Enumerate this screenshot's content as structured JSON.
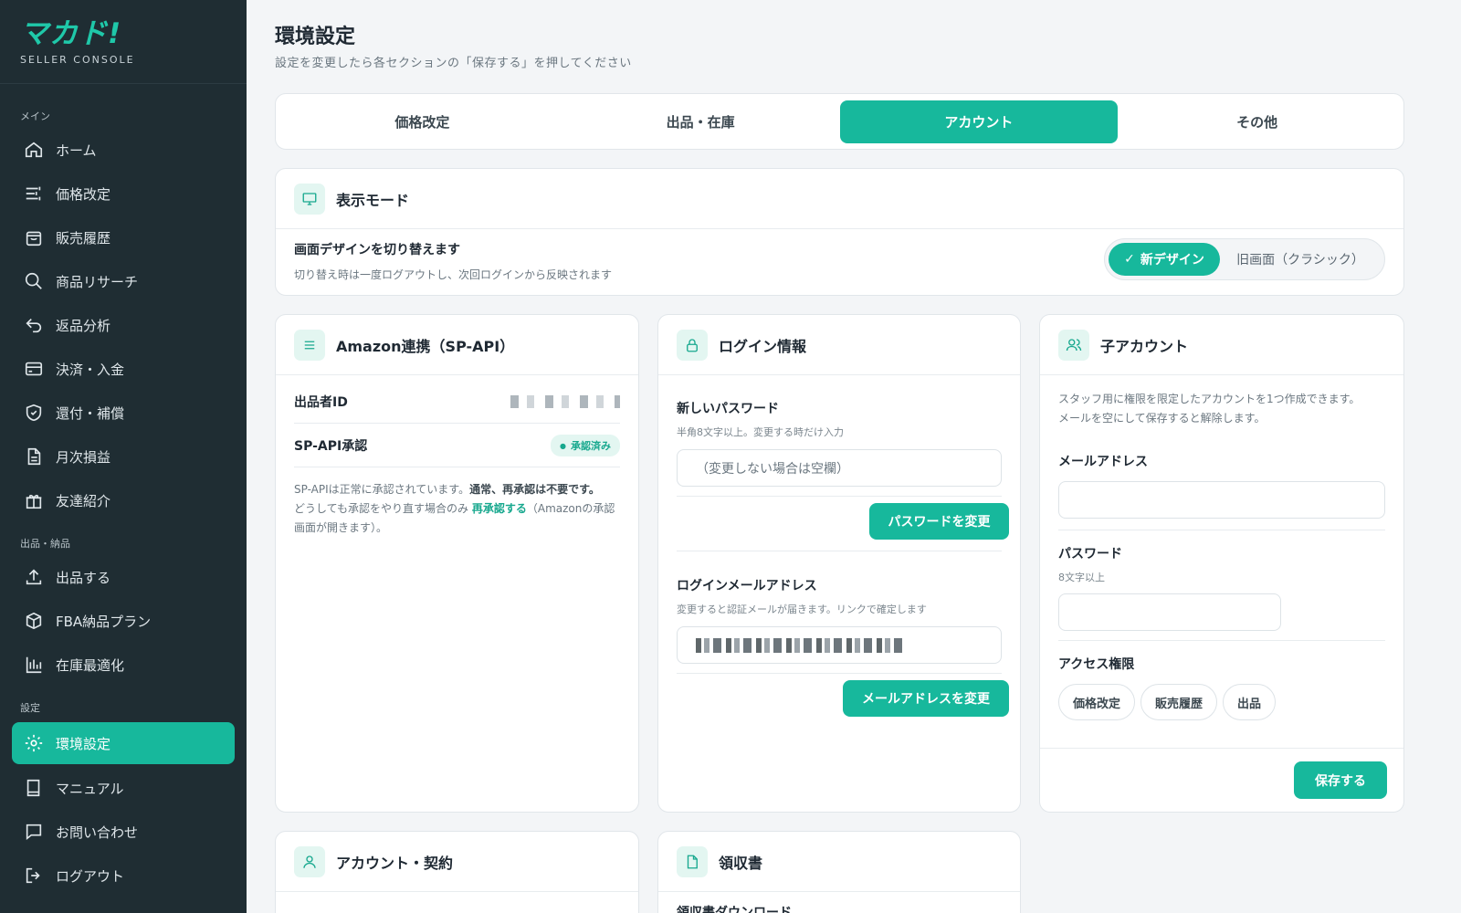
{
  "brand": {
    "logo": "マカド!",
    "sub": "SELLER CONSOLE"
  },
  "sidebar": {
    "sections": [
      {
        "label": "メイン"
      },
      {
        "label": "出品・納品"
      },
      {
        "label": "設定"
      }
    ],
    "items": [
      {
        "label": "ホーム",
        "icon": "home-icon"
      },
      {
        "label": "価格改定",
        "icon": "sliders-icon"
      },
      {
        "label": "販売履歴",
        "icon": "bag-icon"
      },
      {
        "label": "商品リサーチ",
        "icon": "search-icon"
      },
      {
        "label": "返品分析",
        "icon": "return-icon"
      },
      {
        "label": "決済・入金",
        "icon": "card-icon"
      },
      {
        "label": "還付・補償",
        "icon": "shield-icon"
      },
      {
        "label": "月次損益",
        "icon": "document-icon"
      },
      {
        "label": "友達紹介",
        "icon": "gift-icon"
      },
      {
        "label": "出品する",
        "icon": "upload-icon"
      },
      {
        "label": "FBA納品プラン",
        "icon": "box-icon"
      },
      {
        "label": "在庫最適化",
        "icon": "bar-chart-icon"
      },
      {
        "label": "環境設定",
        "icon": "gear-icon"
      },
      {
        "label": "マニュアル",
        "icon": "book-icon"
      },
      {
        "label": "お問い合わせ",
        "icon": "chat-icon"
      },
      {
        "label": "ログアウト",
        "icon": "logout-icon"
      }
    ]
  },
  "page": {
    "title": "環境設定",
    "subtitle": "設定を変更したら各セクションの「保存する」を押してください"
  },
  "tabs": [
    {
      "label": "価格改定"
    },
    {
      "label": "出品・在庫"
    },
    {
      "label": "アカウント"
    },
    {
      "label": "その他"
    }
  ],
  "display_mode": {
    "title": "表示モード",
    "label": "画面デザインを切り替えます",
    "desc": "切り替え時は一度ログアウトし、次回ログインから反映されます",
    "new_label": "新デザイン",
    "check": "✓",
    "old_label": "旧画面（クラシック）"
  },
  "amazon": {
    "title": "Amazon連携（SP-API）",
    "seller_id_label": "出品者ID",
    "spapi_label": "SP-API承認",
    "badge": "承認済み",
    "note_1": "SP-APIは正常に承認されています。",
    "note_2": "通常、再承認は不要です。",
    "note_3": "どうしても承認をやり直す場合のみ ",
    "note_link": "再承認する",
    "note_4": "（Amazonの承認画面が開きます）。"
  },
  "login": {
    "title": "ログイン情報",
    "pw_label": "新しいパスワード",
    "pw_hint": "半角8文字以上。変更する時だけ入力",
    "pw_placeholder": "（変更しない場合は空欄）",
    "pw_button": "パスワードを変更",
    "email_label": "ログインメールアドレス",
    "email_hint": "変更すると認証メールが届きます。リンクで確定します",
    "email_button": "メールアドレスを変更"
  },
  "sub_account": {
    "title": "子アカウント",
    "desc_1": "スタッフ用に権限を限定したアカウントを1つ作成できます。",
    "desc_2": "メールを空にして保存すると解除します。",
    "email_label": "メールアドレス",
    "pw_label": "パスワード",
    "pw_hint": "8文字以上",
    "access_label": "アクセス権限",
    "chips": [
      "価格改定",
      "販売履歴",
      "出品"
    ],
    "save": "保存する"
  },
  "account_contract": {
    "title": "アカウント・契約"
  },
  "receipt": {
    "title": "領収書",
    "download_label": "領収書ダウンロード"
  },
  "colors": {
    "accent": "#17b89c",
    "sidebar": "#1f2d33"
  }
}
